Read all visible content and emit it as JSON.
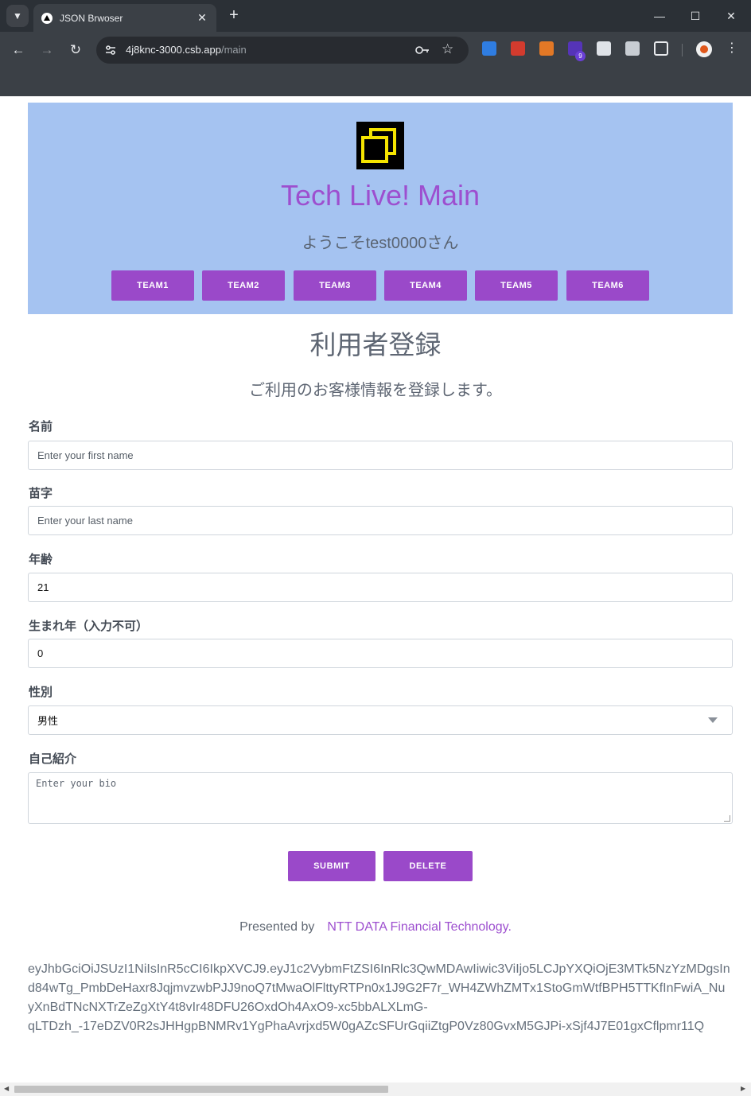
{
  "browser": {
    "tab_title": "JSON Brwoser",
    "url_host": "4j8knc-3000.csb.app",
    "url_path": "/main",
    "extension_badge": "9"
  },
  "header": {
    "app_title": "Tech Live! Main",
    "welcome": "ようこそtest0000さん",
    "teams": [
      "TEAM1",
      "TEAM2",
      "TEAM3",
      "TEAM4",
      "TEAM5",
      "TEAM6"
    ]
  },
  "form": {
    "title": "利用者登録",
    "description": "ご利用のお客様情報を登録します。",
    "first_name": {
      "label": "名前",
      "placeholder": "Enter your first name",
      "value": ""
    },
    "last_name": {
      "label": "苗字",
      "placeholder": "Enter your last name",
      "value": ""
    },
    "age": {
      "label": "年齢",
      "value": "21"
    },
    "birth_year": {
      "label": "生まれ年（入力不可）",
      "value": "0"
    },
    "gender": {
      "label": "性別",
      "value": "男性"
    },
    "bio": {
      "label": "自己紹介",
      "placeholder": "Enter your bio"
    },
    "submit_label": "SUBMIT",
    "delete_label": "DELETE"
  },
  "footer": {
    "presented_by": "Presented by",
    "company": "NTT DATA Financial Technology."
  },
  "token_lines": [
    "eyJhbGciOiJSUzI1NiIsInR5cCI6IkpXVCJ9.eyJ1c2VybmFtZSI6InRlc3QwMDAwIiwic3ViIjo5LCJpYXQiOjE3MTk5NzYzMDgsIn",
    "d84wTg_PmbDeHaxr8JqjmvzwbPJJ9noQ7tMwaOlFlttyRTPn0x1J9G2F7r_WH4ZWhZMTx1StoGmWtfBPH5TTKfInFwiA_Nu",
    "yXnBdTNcNXTrZeZgXtY4t8vIr48DFU26OxdOh4AxO9-xc5bbALXLmG-",
    "qLTDzh_-17eDZV0R2sJHHgpBNMRv1YgPhaAvrjxd5W0gAZcSFUrGqiiZtgP0Vz80GvxM5GJPi-xSjf4J7E01gxCflpmr11Q"
  ]
}
